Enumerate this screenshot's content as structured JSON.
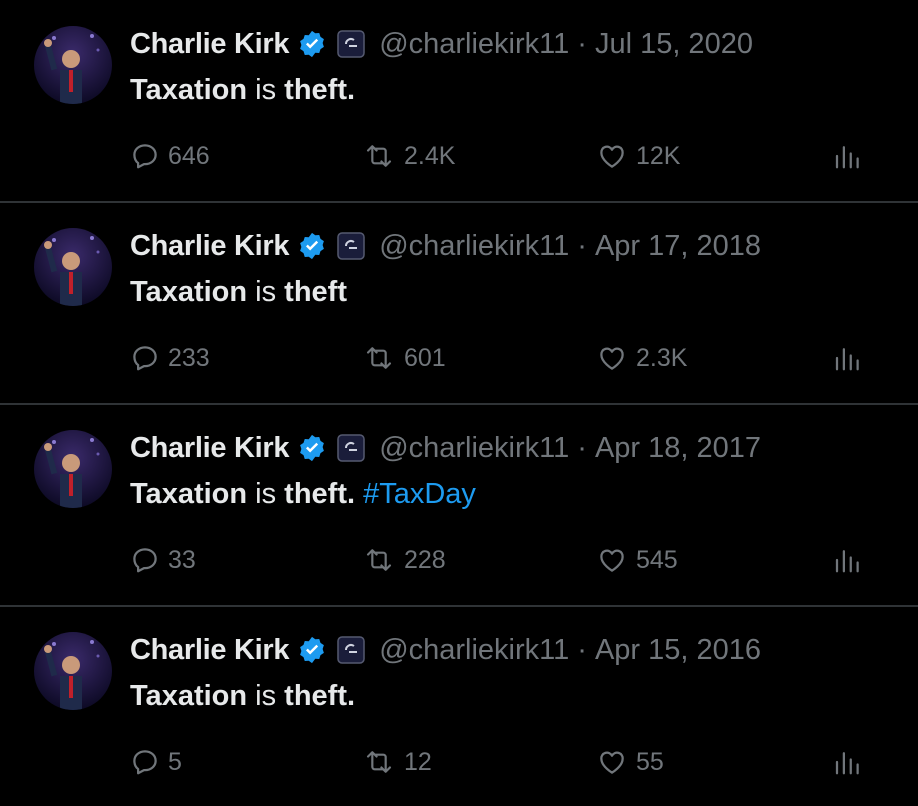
{
  "colors": {
    "background": "#000000",
    "text": "#e7e9ea",
    "muted": "#71767b",
    "accent": "#1d9bf0",
    "divider": "#2f3336"
  },
  "tweets": [
    {
      "name": "Charlie Kirk",
      "handle": "@charliekirk11",
      "separator": "·",
      "date": "Jul 15, 2020",
      "text_a": "Taxation",
      "text_b": " is ",
      "text_c": "theft.",
      "hashtag": "",
      "replies": "646",
      "reposts": "2.4K",
      "likes": "12K",
      "icons": [
        "verified-badge-icon",
        "affiliate-badge-icon",
        "reply-icon",
        "repost-icon",
        "like-icon",
        "views-icon"
      ]
    },
    {
      "name": "Charlie Kirk",
      "handle": "@charliekirk11",
      "separator": "·",
      "date": "Apr 17, 2018",
      "text_a": "Taxation",
      "text_b": " is ",
      "text_c": "theft",
      "hashtag": "",
      "replies": "233",
      "reposts": "601",
      "likes": "2.3K",
      "icons": [
        "verified-badge-icon",
        "affiliate-badge-icon",
        "reply-icon",
        "repost-icon",
        "like-icon",
        "views-icon"
      ]
    },
    {
      "name": "Charlie Kirk",
      "handle": "@charliekirk11",
      "separator": "·",
      "date": "Apr 18, 2017",
      "text_a": "Taxation",
      "text_b": " is ",
      "text_c": "theft.",
      "hashtag": " #TaxDay",
      "replies": "33",
      "reposts": "228",
      "likes": "545",
      "icons": [
        "verified-badge-icon",
        "affiliate-badge-icon",
        "reply-icon",
        "repost-icon",
        "like-icon",
        "views-icon"
      ]
    },
    {
      "name": "Charlie Kirk",
      "handle": "@charliekirk11",
      "separator": "·",
      "date": "Apr 15, 2016",
      "text_a": "Taxation",
      "text_b": " is ",
      "text_c": "theft.",
      "hashtag": "",
      "replies": "5",
      "reposts": "12",
      "likes": "55",
      "icons": [
        "verified-badge-icon",
        "affiliate-badge-icon",
        "reply-icon",
        "repost-icon",
        "like-icon",
        "views-icon"
      ]
    }
  ]
}
